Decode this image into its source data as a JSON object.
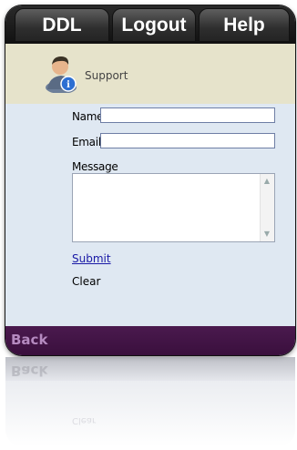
{
  "nav": {
    "tabs": [
      {
        "label": "DDL"
      },
      {
        "label": "Logout"
      },
      {
        "label": "Help"
      }
    ]
  },
  "header": {
    "title": "Support",
    "icon": "support-user-icon"
  },
  "form": {
    "name_label": "Name",
    "name_value": "",
    "email_label": "Email",
    "email_value": "",
    "message_label": "Message",
    "message_value": "",
    "submit_label": "Submit",
    "clear_label": "Clear"
  },
  "footer": {
    "back_label": "Back"
  },
  "colors": {
    "tab_bar": "#1c1c1c",
    "header_band": "#e6e3cb",
    "content_bg": "#dfe8f2",
    "footer": "#3f1342",
    "back_text": "#b58ac0",
    "link": "#1a1aa6"
  }
}
